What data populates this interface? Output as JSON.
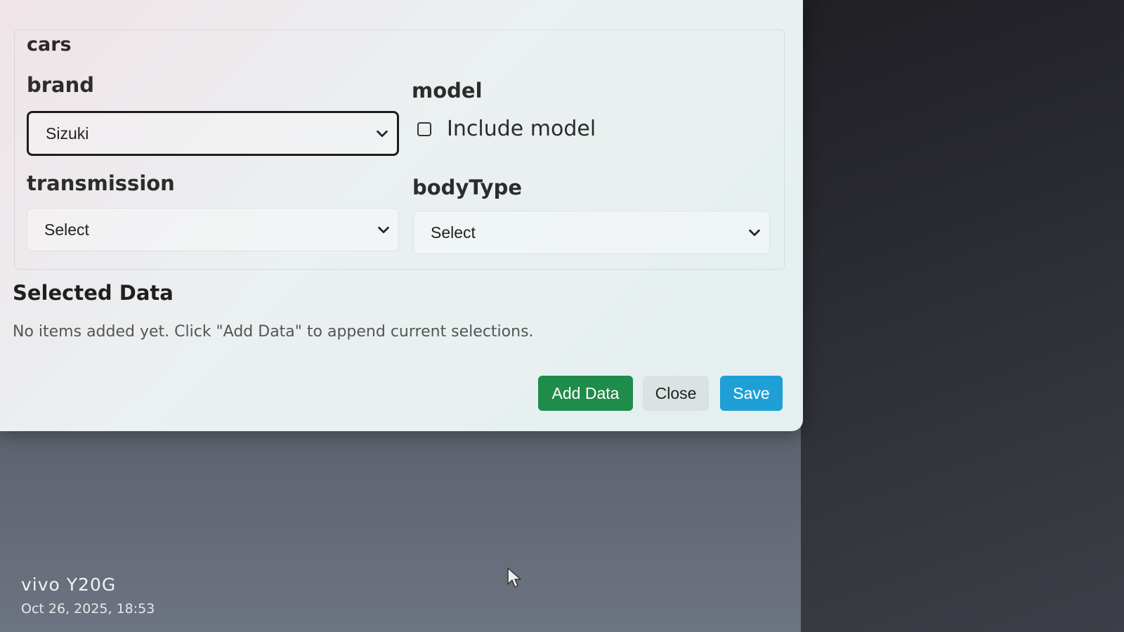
{
  "form": {
    "section_title": "cars",
    "brand": {
      "label": "brand",
      "value": "Sizuki"
    },
    "model": {
      "label": "model",
      "checkbox_label": "Include model",
      "checked": false
    },
    "transmission": {
      "label": "transmission",
      "value": "Select"
    },
    "bodyType": {
      "label": "bodyType",
      "value": "Select"
    }
  },
  "selected": {
    "title": "Selected Data",
    "empty_text": "No items added yet. Click \"Add Data\" to append current selections."
  },
  "buttons": {
    "add": "Add Data",
    "close": "Close",
    "save": "Save"
  },
  "colors": {
    "add": "#1e8c4a",
    "save": "#1ea0d7"
  },
  "watermark": {
    "brand": "vivo Y20G",
    "date": "Oct 26, 2025, 18:53"
  },
  "icons": {
    "dropdown": "chevron-down-icon",
    "cursor": "mouse-pointer-icon"
  }
}
